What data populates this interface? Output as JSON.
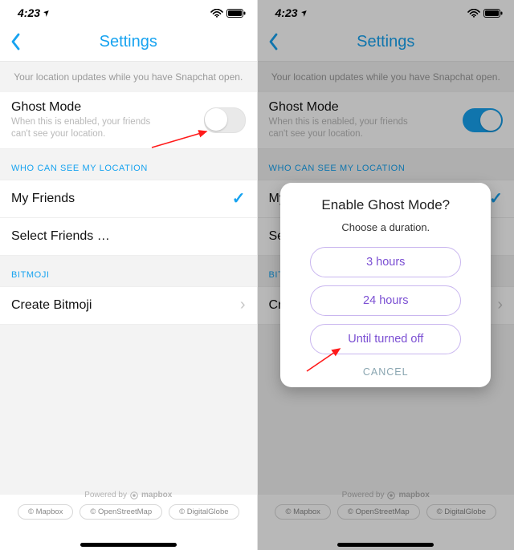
{
  "status": {
    "time": "4:23",
    "loc_glyph": "➤"
  },
  "nav": {
    "title": "Settings"
  },
  "info": "Your location updates while you have Snapchat open.",
  "ghost": {
    "title": "Ghost Mode",
    "sub": "When this is enabled, your friends can't see your location."
  },
  "section_location": "WHO CAN SEE MY LOCATION",
  "loc_options": {
    "my_friends": "My Friends",
    "select_friends": "Select Friends …"
  },
  "section_bitmoji": "BITMOJI",
  "bitmoji_row": "Create Bitmoji",
  "footer": {
    "powered": "Powered by",
    "brand": "mapbox",
    "pills": [
      "© Mapbox",
      "© OpenStreetMap",
      "© DigitalGlobe"
    ]
  },
  "modal": {
    "title": "Enable Ghost Mode?",
    "sub": "Choose a duration.",
    "opt1": "3 hours",
    "opt2": "24 hours",
    "opt3": "Until turned off",
    "cancel": "CANCEL"
  }
}
